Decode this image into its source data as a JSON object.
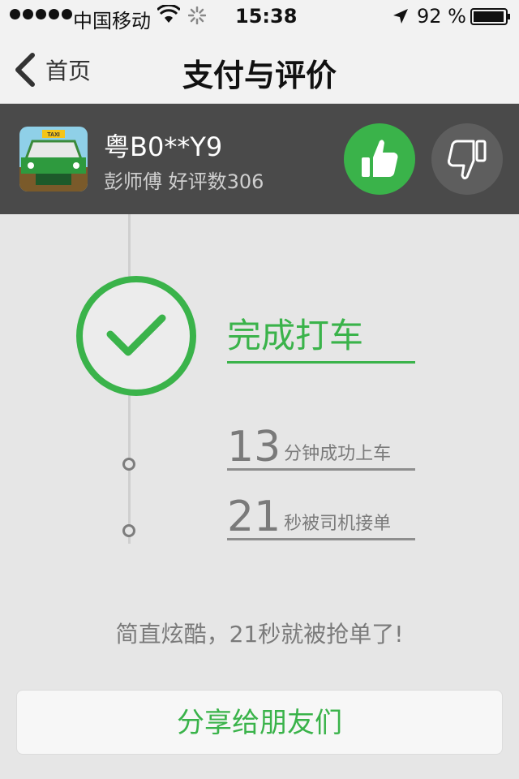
{
  "status_bar": {
    "carrier": "中国移动",
    "time": "15:38",
    "battery": "92 %"
  },
  "nav": {
    "back_label": "首页",
    "title": "支付与评价"
  },
  "driver": {
    "plate": "粤B0**Y9",
    "info": "彭师傅 好评数306",
    "avatar_sign": "TAXI"
  },
  "ride": {
    "status": "完成打车",
    "stat1_value": "13",
    "stat1_label": "分钟成功上车",
    "stat2_value": "21",
    "stat2_label": "秒被司机接单"
  },
  "message": "简直炫酷，21秒就被抢单了!",
  "share_label": "分享给朋友们",
  "colors": {
    "accent_green": "#3ab34a",
    "driver_bar": "#4a4a4a"
  },
  "icons": [
    "signal-icon",
    "wifi-icon",
    "loading-icon",
    "location-arrow-icon",
    "battery-icon",
    "back-chevron-icon",
    "thumbs-up-icon",
    "thumbs-down-icon",
    "checkmark-icon",
    "taxi-avatar-icon"
  ]
}
